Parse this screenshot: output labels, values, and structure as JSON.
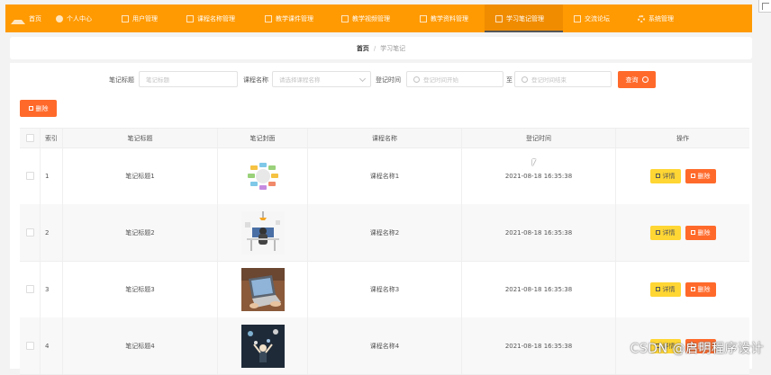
{
  "nav": {
    "items": [
      {
        "label": "首页",
        "icon": "home-icon"
      },
      {
        "label": "个人中心",
        "icon": "user-icon"
      },
      {
        "label": "用户管理",
        "icon": "users-icon"
      },
      {
        "label": "课程名称管理",
        "icon": "book-icon"
      },
      {
        "label": "教学课件管理",
        "icon": "file-icon"
      },
      {
        "label": "教学视频管理",
        "icon": "video-icon"
      },
      {
        "label": "教学资料管理",
        "icon": "folder-icon"
      },
      {
        "label": "学习笔记管理",
        "icon": "note-icon"
      },
      {
        "label": "交流论坛",
        "icon": "chat-icon"
      },
      {
        "label": "系统管理",
        "icon": "gear-icon"
      }
    ],
    "active": "学习笔记管理",
    "bg_color": "#ff9a02"
  },
  "breadcrumb": {
    "home": "首页",
    "separator": "/",
    "current": "学习笔记"
  },
  "filters": {
    "title_label": "笔记标题",
    "title_placeholder": "笔记标题",
    "course_label": "课程名称",
    "course_placeholder": "请选择课程名称",
    "time_label": "登记时间",
    "start_placeholder": "登记时间开始",
    "to_label": "至",
    "end_placeholder": "登记时间结束",
    "query_label": "查询"
  },
  "toolbar": {
    "delete_label": "删除"
  },
  "table": {
    "headers": {
      "index": "索引",
      "title": "笔记标题",
      "cover": "笔记封面",
      "course": "课程名称",
      "time": "登记时间",
      "actions": "操作"
    },
    "rows": [
      {
        "index": "1",
        "title": "笔记标题1",
        "course": "课程名称1",
        "time": "2021-08-18 16:35:38",
        "cover": "mind-map-image"
      },
      {
        "index": "2",
        "title": "笔记标题2",
        "course": "课程名称2",
        "time": "2021-08-18 16:35:38",
        "cover": "desk-illustration-image"
      },
      {
        "index": "3",
        "title": "笔记标题3",
        "course": "课程名称3",
        "time": "2021-08-18 16:35:38",
        "cover": "laptop-photo-image"
      },
      {
        "index": "4",
        "title": "笔记标题4",
        "course": "课程名称4",
        "time": "2021-08-18 16:35:38",
        "cover": "celebration-photo-image"
      }
    ],
    "detail_label": "详情",
    "delete_label": "删除"
  },
  "watermark": "CSDN @启明程序设计",
  "colors": {
    "accent": "#ff9a02",
    "danger": "#ff6a2b",
    "warning": "#ffd633"
  }
}
